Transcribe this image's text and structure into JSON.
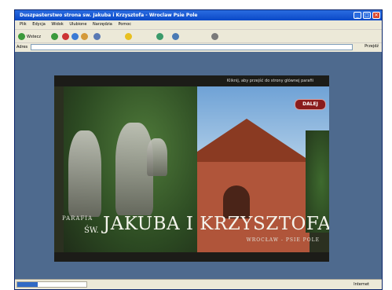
{
  "window": {
    "title": "Duszpasterstwo strona sw. Jakuba i Krzysztofa - Wroclaw Psie Pole",
    "controls": {
      "minimize": "_",
      "maximize": "□",
      "close": "✕"
    }
  },
  "menubar": {
    "items": [
      "Plik",
      "Edycja",
      "Widok",
      "Ulubione",
      "Narzędzia",
      "Pomoc"
    ]
  },
  "toolbar": {
    "back_label": "Wstecz",
    "icons": [
      "back-icon",
      "forward-icon",
      "stop-icon",
      "refresh-icon",
      "home-icon",
      "search-icon",
      "favorites-icon",
      "history-icon",
      "mail-icon",
      "print-icon"
    ]
  },
  "addressbar": {
    "label": "Adres",
    "go_label": "Przejdź"
  },
  "banner": {
    "top_text": "Kliknij, aby przejść do strony głównej parafii",
    "dalej": "DALEJ",
    "parafia": "PARAFIA",
    "sw": "ŚW.",
    "name": "JAKUBA I KRZYSZTOFA",
    "city": "WROCŁAW - PSIE POLE"
  },
  "statusbar": {
    "zone": "Internet",
    "progress": 0.3
  }
}
